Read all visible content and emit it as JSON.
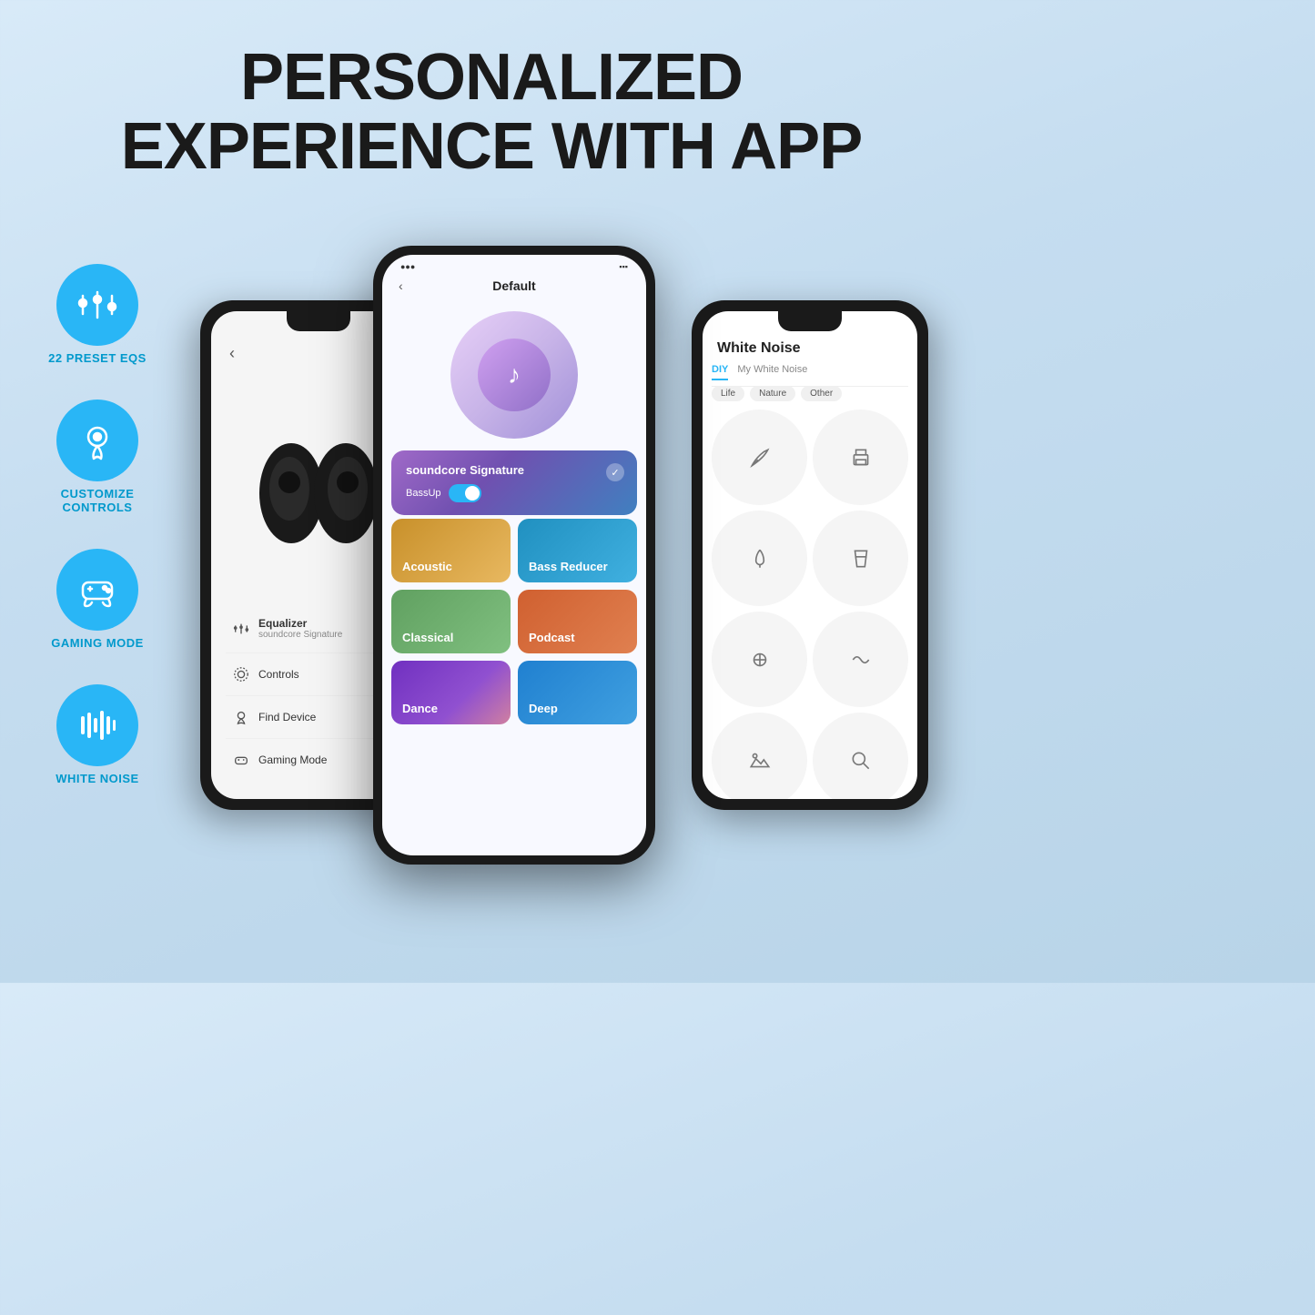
{
  "headline": {
    "line1": "PERSONALIZED",
    "line2": "EXPERIENCE WITH APP"
  },
  "features": [
    {
      "id": "equalizer",
      "label": "22 PRESET EQS",
      "icon": "equalizer-icon"
    },
    {
      "id": "customize",
      "label": "CUSTOMIZE CONTROLS",
      "icon": "touch-icon"
    },
    {
      "id": "gaming",
      "label": "GAMING MODE",
      "icon": "gamepad-icon"
    },
    {
      "id": "whitenoise",
      "label": "WHITE NOISE",
      "icon": "waves-icon"
    }
  ],
  "left_phone": {
    "back": "‹",
    "menu_items": [
      {
        "icon": "equalizer",
        "title": "Equalizer",
        "subtitle": "soundcore Signature"
      },
      {
        "icon": "controls",
        "title": "Controls",
        "subtitle": ""
      },
      {
        "icon": "find",
        "title": "Find Device",
        "subtitle": ""
      },
      {
        "icon": "gaming",
        "title": "Gaming Mode",
        "subtitle": ""
      }
    ]
  },
  "center_phone": {
    "nav_title": "Default",
    "back": "‹",
    "signature_label": "soundcore Signature",
    "bassup_label": "BassUp",
    "eq_presets": [
      {
        "name": "Acoustic",
        "style": "acoustic"
      },
      {
        "name": "Bass Reducer",
        "style": "bass-reducer"
      },
      {
        "name": "Classical",
        "style": "classical"
      },
      {
        "name": "Podcast",
        "style": "podcast"
      },
      {
        "name": "Dance",
        "style": "dance"
      },
      {
        "name": "Deep",
        "style": "deep"
      }
    ]
  },
  "right_phone": {
    "title": "White Noise",
    "tabs": [
      "DIY",
      "My White Noise"
    ],
    "active_tab": "DIY",
    "filters": [
      "Life",
      "Nature",
      "Other"
    ],
    "noise_icons": [
      "quill",
      "printer",
      "food",
      "drinks",
      "dining",
      "activity",
      "landscape",
      "search",
      "tree",
      "beach",
      "fire",
      "sparkle"
    ]
  }
}
